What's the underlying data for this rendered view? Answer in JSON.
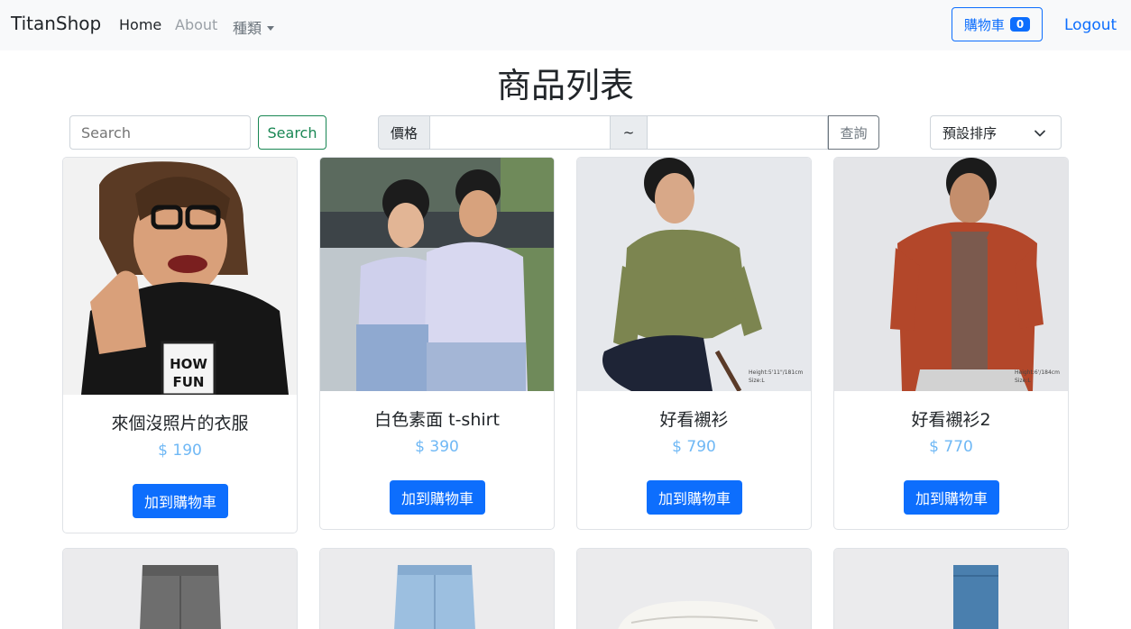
{
  "navbar": {
    "brand": "TitanShop",
    "links": [
      {
        "label": "Home"
      },
      {
        "label": "About"
      },
      {
        "label": "種類"
      }
    ],
    "cart_label": "購物車",
    "cart_count": "0",
    "logout_label": "Logout"
  },
  "page_title": "商品列表",
  "filters": {
    "search_placeholder": "Search",
    "search_button": "Search",
    "price_label": "價格",
    "range_sep": "~",
    "query_button": "查詢",
    "sort_selected": "預設排序"
  },
  "products": [
    {
      "name": "來個沒照片的衣服",
      "price": "$ 190",
      "button": "加到購物車",
      "image": "person-thumbs-up-black-tshirt"
    },
    {
      "name": "白色素面 t-shirt",
      "price": "$ 390",
      "button": "加到購物車",
      "image": "couple-lavender-tshirts"
    },
    {
      "name": "好看襯衫",
      "price": "$ 790",
      "button": "加到購物車",
      "image": "man-olive-shirt-seated"
    },
    {
      "name": "好看襯衫2",
      "price": "$ 770",
      "button": "加到購物車",
      "image": "man-rust-shirt"
    }
  ],
  "products_row2": [
    {
      "image": "grey-jeans"
    },
    {
      "image": "light-blue-denim-shorts"
    },
    {
      "image": "white-sandal"
    },
    {
      "image": "blue-sock"
    }
  ],
  "colors": {
    "primary": "#0d6efd",
    "success": "#198754",
    "price": "#6fb8f5",
    "navbar_bg": "#f8f9fa"
  }
}
